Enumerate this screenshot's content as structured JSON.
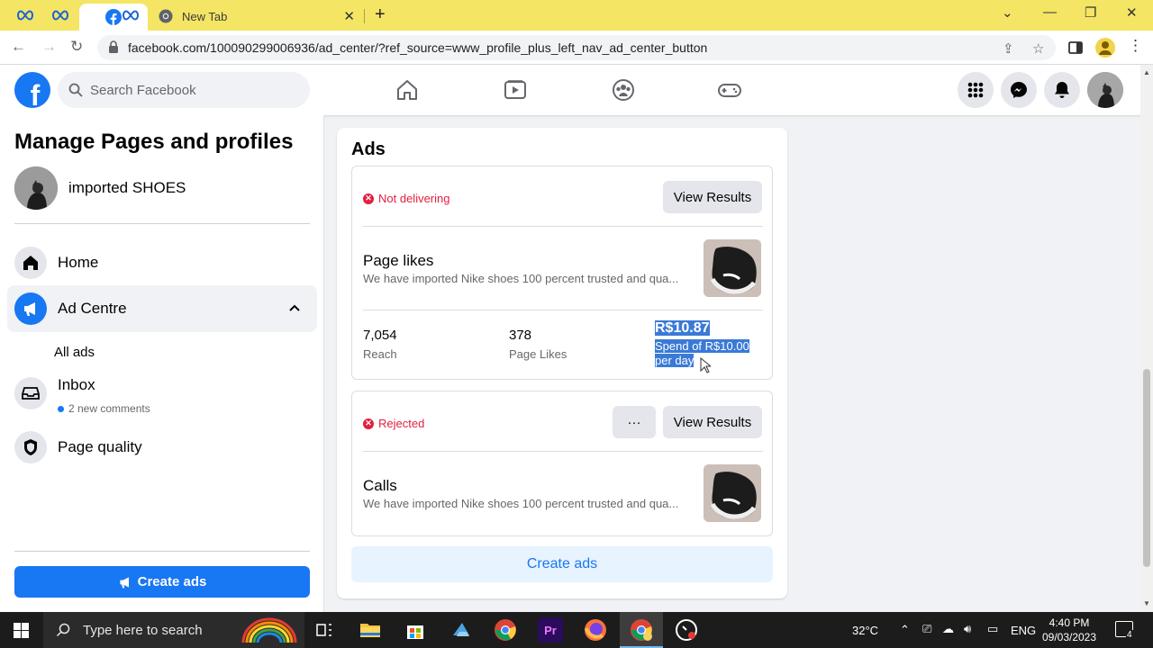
{
  "browser": {
    "tabs": [
      {
        "icon": "meta-icon"
      },
      {
        "icon": "meta-icon"
      },
      {
        "icon": "facebook-icon",
        "active": true
      },
      {
        "icon": "meta-icon"
      },
      {
        "icon": "chrome-icon",
        "label": "New Tab"
      }
    ],
    "url": "facebook.com/100090299006936/ad_center/?ref_source=www_profile_plus_left_nav_ad_center_button"
  },
  "header": {
    "logo": "f",
    "search_placeholder": "Search Facebook"
  },
  "sidebar": {
    "title": "Manage Pages and profiles",
    "page_name": "imported SHOES",
    "items": [
      {
        "label": "Home",
        "icon": "home-icon"
      },
      {
        "label": "Ad Centre",
        "icon": "megaphone-icon",
        "active": true
      },
      {
        "label": "All ads"
      },
      {
        "label": "Inbox",
        "icon": "inbox-icon",
        "sub": "2 new comments"
      },
      {
        "label": "Page quality",
        "icon": "shield-icon"
      }
    ],
    "create_button": "Create ads"
  },
  "main": {
    "title": "Ads",
    "ads": [
      {
        "status": "Not delivering",
        "view_results": "View Results",
        "objective": "Page likes",
        "description": "We have imported Nike shoes 100 percent trusted and qua...",
        "metrics": [
          {
            "value": "7,054",
            "label": "Reach"
          },
          {
            "value": "378",
            "label": "Page Likes"
          }
        ],
        "spend": "R$10.87",
        "spend_sub": "Spend of R$10.00 per day"
      },
      {
        "status": "Rejected",
        "more": "···",
        "view_results": "View Results",
        "objective": "Calls",
        "description": "We have imported Nike shoes 100 percent trusted and qua..."
      }
    ],
    "create_button": "Create ads"
  },
  "taskbar": {
    "search_placeholder": "Type here to search",
    "temperature": "32°C",
    "language": "ENG",
    "time": "4:40 PM",
    "date": "09/03/2023",
    "notifications": "4"
  },
  "colors": {
    "facebook_blue": "#1877f2",
    "error_red": "#e41e3f",
    "tabbar_yellow": "#f4e565"
  }
}
